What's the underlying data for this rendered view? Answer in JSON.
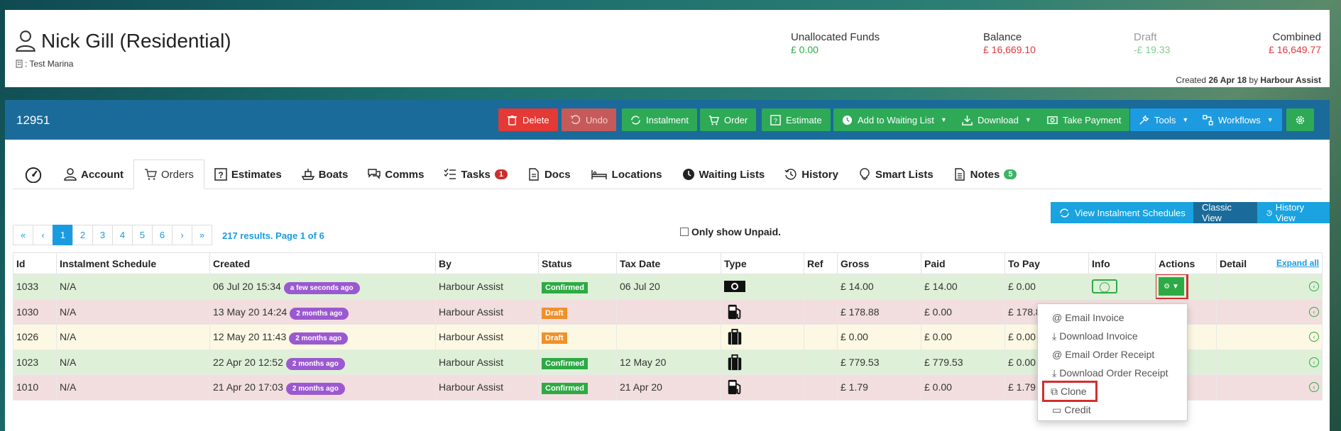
{
  "header": {
    "customer_name": "Nick Gill (Residential)",
    "marina": ": Test Marina",
    "unallocated_label": "Unallocated Funds",
    "unallocated_value": "£ 0.00",
    "balance_label": "Balance",
    "balance_value": "£ 16,669.10",
    "draft_label": "Draft",
    "draft_value": "-£ 19.33",
    "combined_label": "Combined",
    "combined_value": "£ 16,649.77",
    "created_prefix": "Created",
    "created_date": "26 Apr 18",
    "created_by_prefix": "by",
    "created_by": "Harbour Assist"
  },
  "toolbar": {
    "record_id": "12951",
    "delete": "Delete",
    "undo": "Undo",
    "instalment": "Instalment",
    "order": "Order",
    "estimate": "Estimate",
    "add_waiting": "Add to Waiting List",
    "download": "Download",
    "take_payment": "Take Payment",
    "tools": "Tools",
    "workflows": "Workflows"
  },
  "tabs": [
    {
      "label": ""
    },
    {
      "label": "Account"
    },
    {
      "label": "Orders"
    },
    {
      "label": "Estimates"
    },
    {
      "label": "Boats"
    },
    {
      "label": "Comms"
    },
    {
      "label": "Tasks",
      "badge": "1"
    },
    {
      "label": "Docs"
    },
    {
      "label": "Locations"
    },
    {
      "label": "Waiting Lists"
    },
    {
      "label": "History"
    },
    {
      "label": "Smart Lists"
    },
    {
      "label": "Notes",
      "badge": "5"
    }
  ],
  "controls": {
    "view_instalment_schedules": "View Instalment Schedules",
    "classic_view": "Classic View",
    "history_view": "History View",
    "only_unpaid": "Only show Unpaid.",
    "results": "217 results. Page 1 of 6"
  },
  "pagination": [
    "«",
    "‹",
    "1",
    "2",
    "3",
    "4",
    "5",
    "6",
    "›",
    "»"
  ],
  "table": {
    "headers": [
      "Id",
      "Instalment Schedule",
      "Created",
      "By",
      "Status",
      "Tax Date",
      "Type",
      "Ref",
      "Gross",
      "Paid",
      "To Pay",
      "Info",
      "Actions",
      "Detail"
    ],
    "expand_all": "Expand all",
    "rows": [
      {
        "id": "1033",
        "sched": "N/A",
        "created": "06 Jul 20 15:34",
        "ago": "a few seconds ago",
        "by": "Harbour Assist",
        "status": "Confirmed",
        "tax": "06 Jul 20",
        "type": "cash",
        "ref": "",
        "gross": "£ 14.00",
        "paid": "£ 14.00",
        "topay": "£ 0.00"
      },
      {
        "id": "1030",
        "sched": "N/A",
        "created": "13 May 20 14:24",
        "ago": "2 months ago",
        "by": "Harbour Assist",
        "status": "Draft",
        "tax": "",
        "type": "fuel",
        "ref": "",
        "gross": "£ 178.88",
        "paid": "£ 0.00",
        "topay": "£ 178.88"
      },
      {
        "id": "1026",
        "sched": "N/A",
        "created": "12 May 20 11:43",
        "ago": "2 months ago",
        "by": "Harbour Assist",
        "status": "Draft",
        "tax": "",
        "type": "bag",
        "ref": "",
        "gross": "£ 0.00",
        "paid": "£ 0.00",
        "topay": "£ 0.00"
      },
      {
        "id": "1023",
        "sched": "N/A",
        "created": "22 Apr 20 12:52",
        "ago": "2 months ago",
        "by": "Harbour Assist",
        "status": "Confirmed",
        "tax": "12 May 20",
        "type": "bag",
        "ref": "",
        "gross": "£ 779.53",
        "paid": "£ 779.53",
        "topay": "£ 0.00"
      },
      {
        "id": "1010",
        "sched": "N/A",
        "created": "21 Apr 20 17:03",
        "ago": "2 months ago",
        "by": "Harbour Assist",
        "status": "Confirmed",
        "tax": "21 Apr 20",
        "type": "fuel",
        "ref": "",
        "gross": "£ 1.79",
        "paid": "£ 0.00",
        "topay": "£ 1.79"
      }
    ]
  },
  "dropdown": {
    "email_invoice": "Email Invoice",
    "download_invoice": "Download Invoice",
    "email_order_receipt": "Email Order Receipt",
    "download_order_receipt": "Download Order Receipt",
    "clone": "Clone",
    "credit": "Credit"
  }
}
